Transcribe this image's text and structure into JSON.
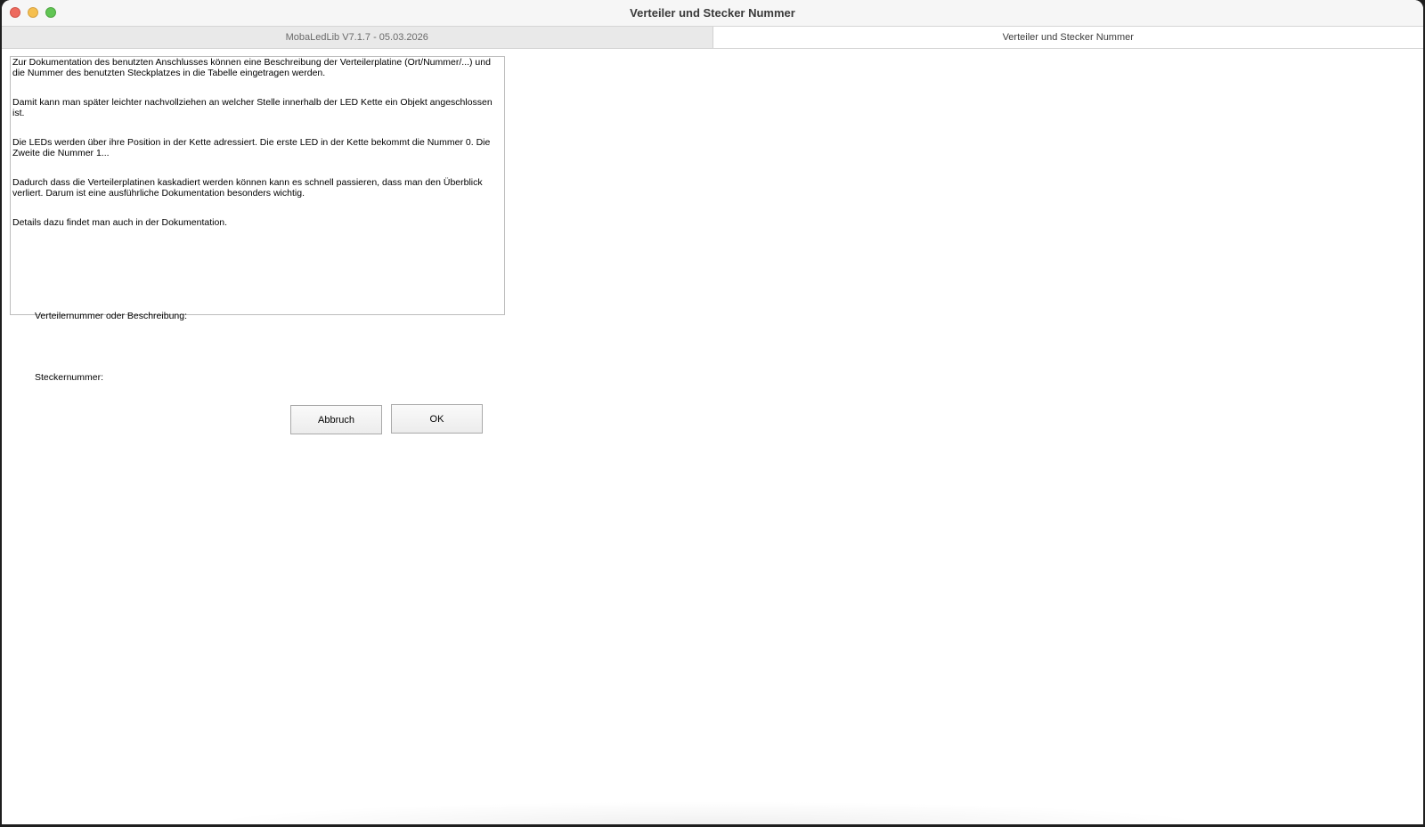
{
  "window": {
    "title": "Verteiler und Stecker Nummer"
  },
  "tabs": [
    {
      "label": "MobaLedLib V7.1.7 - 05.03.2026",
      "active": false
    },
    {
      "label": "Verteiler und Stecker Nummer",
      "active": true
    }
  ],
  "info": {
    "paragraphs": [
      "Zur Dokumentation des benutzten Anschlusses können eine Beschreibung der Verteilerplatine (Ort/Nummer/...) und die Nummer des benutzten Steckplatzes in die Tabelle eingetragen werden.",
      "Damit kann man später leichter nachvollziehen an welcher Stelle innerhalb der LED Kette ein Objekt angeschlossen ist.",
      "Die LEDs werden über ihre Position in der Kette adressiert. Die erste LED in der Kette bekommt die Nummer 0. Die Zweite die Nummer 1...",
      "Dadurch dass die Verteilerplatinen kaskadiert werden können kann es schnell passieren, dass man den Überblick verliert. Darum ist eine ausführliche Dokumentation besonders wichtig.",
      "Details dazu findet man auch in der Dokumentation."
    ]
  },
  "form": {
    "distributor_label": "Verteilernummer oder Beschreibung:",
    "plug_label": "Steckernummer:"
  },
  "buttons": {
    "cancel_label": "Abbruch",
    "ok_label": "OK"
  },
  "colors": {
    "close": "#ed6a5e",
    "minimize": "#f5bf4f",
    "zoom": "#61c554"
  }
}
